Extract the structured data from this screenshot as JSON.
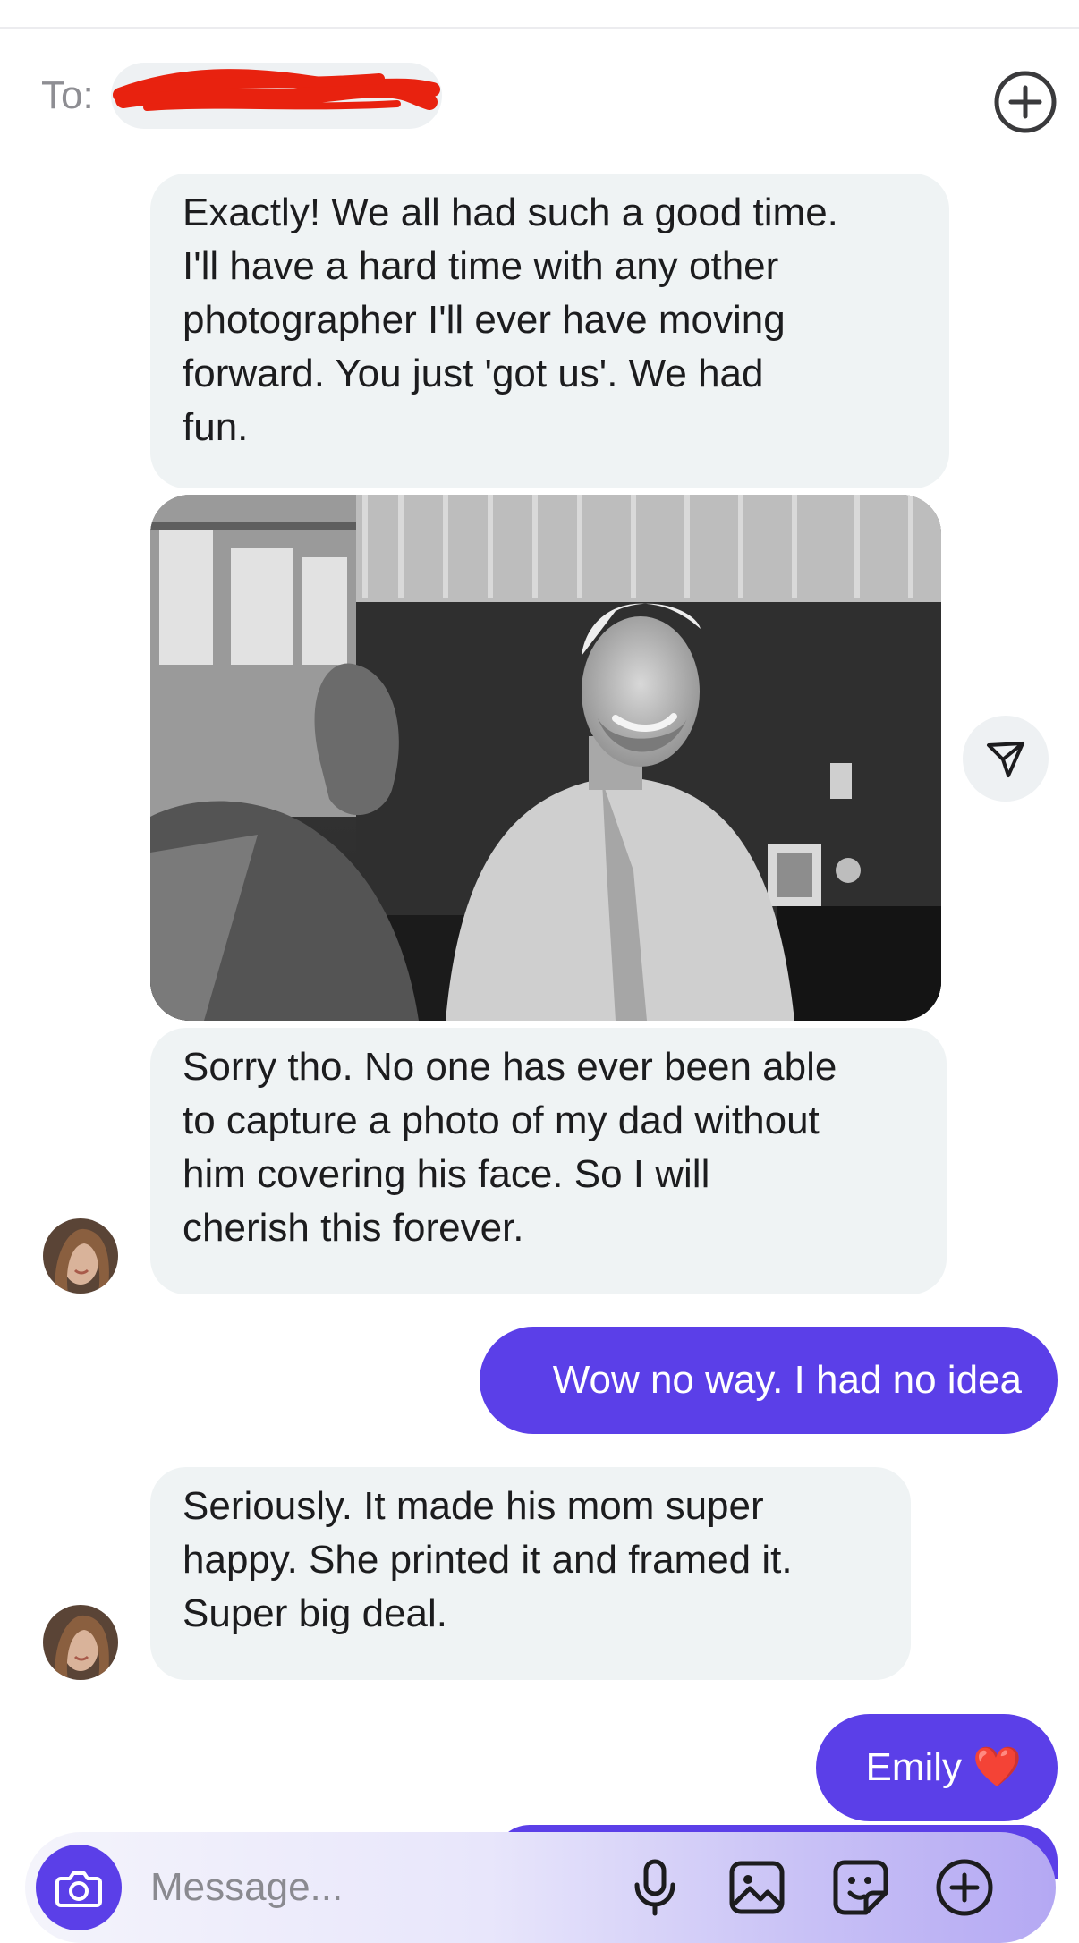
{
  "header": {
    "to_label": "To:"
  },
  "messages": [
    {
      "direction": "incoming",
      "lines": [
        "Exactly! We all had such a good time.",
        "I'll have a hard time with any other",
        "photographer I'll ever have moving",
        "forward. You just 'got us'. We had",
        "fun."
      ]
    },
    {
      "direction": "incoming",
      "type": "photo"
    },
    {
      "direction": "incoming",
      "lines": [
        "Sorry tho. No one has ever been able",
        "to capture a photo of my dad without",
        "him covering his face. So I will",
        "cherish this forever."
      ]
    },
    {
      "direction": "outgoing",
      "text": "Wow no way. I had no idea"
    },
    {
      "direction": "incoming",
      "lines": [
        "Seriously. It made his mom super",
        "happy. She printed it and framed it.",
        "Super big deal."
      ]
    },
    {
      "direction": "outgoing",
      "text": "Emily ❤️"
    }
  ],
  "composer": {
    "placeholder": "Message..."
  },
  "icons": {
    "add_recipient": "plus-circle-icon",
    "share": "send-icon",
    "camera": "camera-icon",
    "mic": "microphone-icon",
    "gallery": "image-icon",
    "sticker": "sticker-icon",
    "more": "plus-circle-icon"
  },
  "colors": {
    "outgoing_bubble": "#5b3fe8",
    "incoming_bubble": "#eff3f4",
    "redaction": "#e8220f"
  }
}
